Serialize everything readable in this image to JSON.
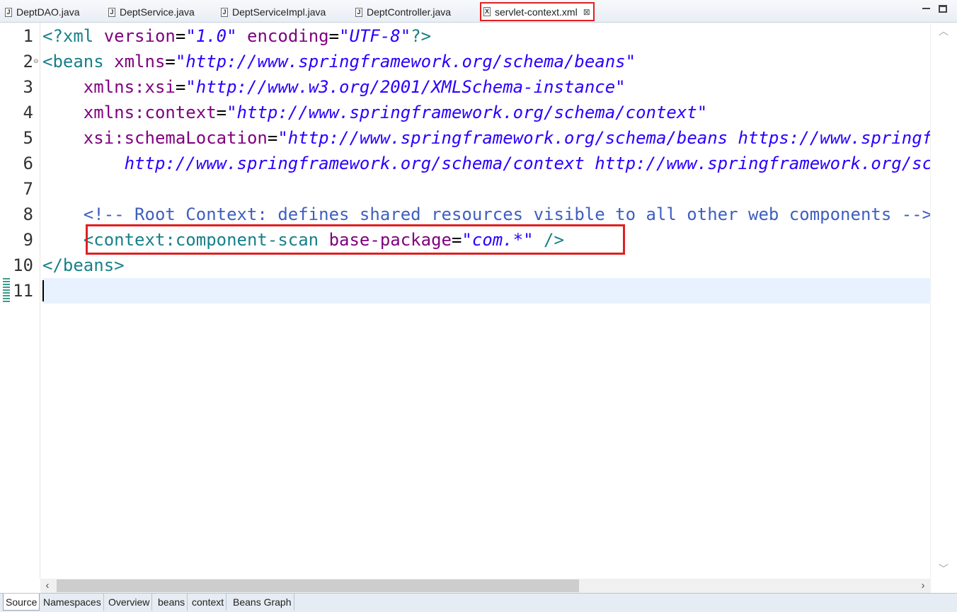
{
  "tabs": [
    {
      "label": "DeptDAO.java",
      "icon": "java-file-icon"
    },
    {
      "label": "DeptService.java",
      "icon": "java-file-icon"
    },
    {
      "label": "DeptServiceImpl.java",
      "icon": "java-file-icon"
    },
    {
      "label": "DeptController.java",
      "icon": "java-file-icon"
    },
    {
      "label": "servlet-context.xml",
      "icon": "xml-file-icon",
      "active": true,
      "close": "⊠"
    }
  ],
  "editor": {
    "line_numbers": [
      "1",
      "2",
      "3",
      "4",
      "5",
      "6",
      "7",
      "8",
      "9",
      "10",
      "11"
    ],
    "lines": [
      {
        "segments": [
          {
            "t": "<?xml ",
            "c": "tagc"
          },
          {
            "t": "version",
            "c": "attr"
          },
          {
            "t": "=",
            "c": "eq"
          },
          {
            "t": "\"1.0\"",
            "c": "val"
          },
          {
            "t": " ",
            "c": "eq"
          },
          {
            "t": "encoding",
            "c": "attr"
          },
          {
            "t": "=",
            "c": "eq"
          },
          {
            "t": "\"UTF-8\"",
            "c": "val"
          },
          {
            "t": "?>",
            "c": "tagc"
          }
        ]
      },
      {
        "segments": [
          {
            "t": "<beans ",
            "c": "tagc"
          },
          {
            "t": "xmlns",
            "c": "attr"
          },
          {
            "t": "=",
            "c": "eq"
          },
          {
            "t": "\"http://www.springframework.org/schema/beans\"",
            "c": "val"
          }
        ]
      },
      {
        "segments": [
          {
            "t": "    ",
            "c": "eq"
          },
          {
            "t": "xmlns:xsi",
            "c": "attr"
          },
          {
            "t": "=",
            "c": "eq"
          },
          {
            "t": "\"http://www.w3.org/2001/XMLSchema-instance\"",
            "c": "val"
          }
        ]
      },
      {
        "segments": [
          {
            "t": "    ",
            "c": "eq"
          },
          {
            "t": "xmlns:context",
            "c": "attr"
          },
          {
            "t": "=",
            "c": "eq"
          },
          {
            "t": "\"http://www.springframework.org/schema/context\"",
            "c": "val"
          }
        ]
      },
      {
        "segments": [
          {
            "t": "    ",
            "c": "eq"
          },
          {
            "t": "xsi:schemaLocation",
            "c": "attr"
          },
          {
            "t": "=",
            "c": "eq"
          },
          {
            "t": "\"http://www.springframework.org/schema/beans https://www.springframework.org/schema/beans/spring-beans.xsd",
            "c": "val"
          }
        ]
      },
      {
        "segments": [
          {
            "t": "        ",
            "c": "eq"
          },
          {
            "t": "http://www.springframework.org/schema/context http://www.springframework.org/schema/context/spring-context.xsd\">",
            "c": "val"
          }
        ]
      },
      {
        "segments": []
      },
      {
        "segments": [
          {
            "t": "    ",
            "c": "eq"
          },
          {
            "t": "<!-- Root Context: defines shared resources visible to all other web components -->",
            "c": "com"
          }
        ]
      },
      {
        "segments": [
          {
            "t": "    ",
            "c": "eq"
          },
          {
            "t": "<context:component-scan ",
            "c": "tagc"
          },
          {
            "t": "base-package",
            "c": "attr"
          },
          {
            "t": "=",
            "c": "eq"
          },
          {
            "t": "\"com.*\"",
            "c": "val"
          },
          {
            "t": " />",
            "c": "tagc"
          }
        ]
      },
      {
        "segments": [
          {
            "t": "</beans>",
            "c": "tagc"
          }
        ]
      },
      {
        "segments": []
      }
    ],
    "current_line": 11,
    "folding_line": 2
  },
  "page_tabs": [
    {
      "label": "Source",
      "active": true
    },
    {
      "label": "Namespaces"
    },
    {
      "label": "Overview"
    },
    {
      "label": "beans"
    },
    {
      "label": "context"
    },
    {
      "label": "Beans Graph"
    }
  ],
  "colors": {
    "tag": "#17808a",
    "attribute": "#7f007f",
    "value": "#2a00ff",
    "comment": "#3f5fbf",
    "highlight_box": "#e02020",
    "current_line": "#e8f2fe"
  }
}
